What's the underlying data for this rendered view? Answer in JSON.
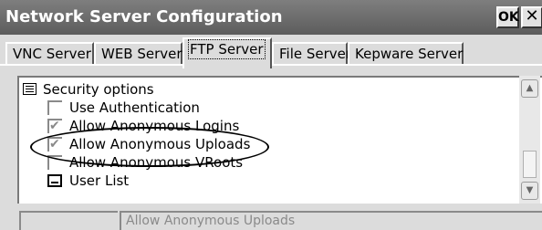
{
  "window": {
    "title": "Network Server Configuration",
    "ok_label": "OK",
    "close_label": "✕"
  },
  "tabs": [
    {
      "label": "VNC Server",
      "active": false
    },
    {
      "label": "WEB Server",
      "active": false
    },
    {
      "label": "FTP Server",
      "active": true
    },
    {
      "label": "File Server",
      "active": false
    },
    {
      "label": "Kepware Server",
      "active": false
    }
  ],
  "options": {
    "group_label": "Security options",
    "items": [
      {
        "label": "Use Authentication",
        "checked": false
      },
      {
        "label": "Allow Anonymous Logins",
        "checked": true
      },
      {
        "label": "Allow Anonymous Uploads",
        "checked": true
      },
      {
        "label": "Allow Anonymous VRoots",
        "checked": false
      },
      {
        "label": "User List",
        "type": "list"
      }
    ]
  },
  "status": {
    "left": "",
    "description": "Allow Anonymous Uploads"
  }
}
